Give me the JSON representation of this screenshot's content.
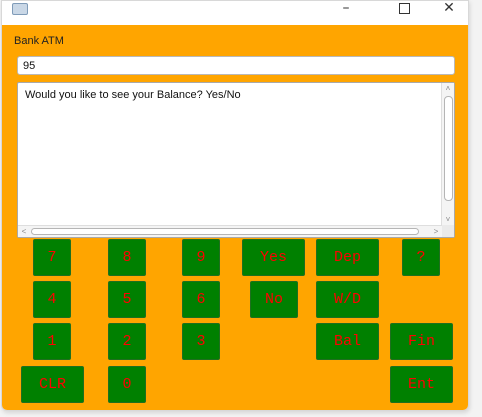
{
  "window": {
    "minimize_glyph": "–",
    "close_glyph": "✕"
  },
  "app": {
    "title": "Bank ATM",
    "input_value": "95",
    "display_text": "Would you like to see your Balance? Yes/No"
  },
  "scrollbars": {
    "up_arrow": "˄",
    "down_arrow": "˅",
    "left_arrow": "<",
    "right_arrow": ">"
  },
  "keypad": {
    "k7": "7",
    "k8": "8",
    "k9": "9",
    "k4": "4",
    "k5": "5",
    "k6": "6",
    "k1": "1",
    "k2": "2",
    "k3": "3",
    "k0": "0",
    "clr": "CLR",
    "yes": "Yes",
    "no": "No",
    "dep": "Dep",
    "wd": "W/D",
    "bal": "Bal",
    "help": "?",
    "fin": "Fin",
    "ent": "Ent"
  },
  "colors": {
    "background": "#ffa500",
    "button": "#008000",
    "button_text": "#ff0000"
  }
}
